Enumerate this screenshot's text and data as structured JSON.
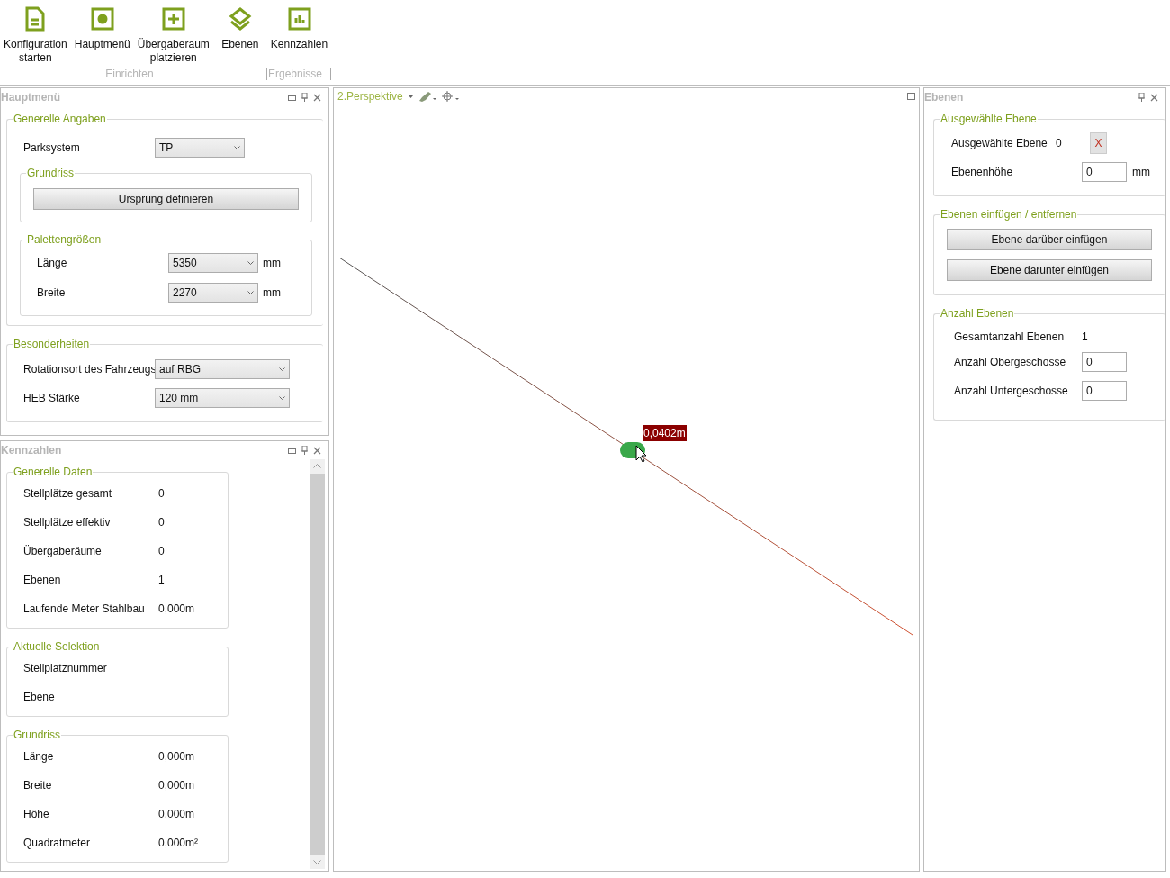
{
  "ribbon": {
    "groups": [
      {
        "label": "Einrichten",
        "buttons": [
          {
            "label": "Konfiguration\nstarten"
          },
          {
            "label": "Hauptmenü"
          },
          {
            "label": "Übergaberaum\nplatzieren"
          },
          {
            "label": "Ebenen"
          }
        ]
      },
      {
        "label": "Ergebnisse",
        "buttons": [
          {
            "label": "Kennzahlen"
          }
        ]
      }
    ]
  },
  "hauptmenue": {
    "title": "Hauptmenü",
    "generelle_angaben": {
      "title": "Generelle Angaben",
      "parksystem": {
        "label": "Parksystem",
        "value": "TP"
      },
      "grundriss": {
        "title": "Grundriss",
        "button": "Ursprung definieren"
      },
      "palettengroessen": {
        "title": "Palettengrößen",
        "rows": [
          {
            "label": "Länge",
            "value": "5350",
            "unit": "mm"
          },
          {
            "label": "Breite",
            "value": "2270",
            "unit": "mm"
          }
        ]
      }
    },
    "besonderheiten": {
      "title": "Besonderheiten",
      "rows": [
        {
          "label": "Rotationsort des Fahrzeugs",
          "value": "auf RBG"
        },
        {
          "label": "HEB Stärke",
          "value": "120 mm"
        }
      ]
    }
  },
  "kennzahlen": {
    "title": "Kennzahlen",
    "sections": [
      {
        "title": "Generelle Daten",
        "rows": [
          {
            "label": "Stellplätze gesamt",
            "value": "0"
          },
          {
            "label": "Stellplätze effektiv",
            "value": "0"
          },
          {
            "label": "Übergaberäume",
            "value": "0"
          },
          {
            "label": "Ebenen",
            "value": "1"
          },
          {
            "label": "Laufende Meter Stahlbau",
            "value": "0,000m"
          }
        ]
      },
      {
        "title": "Aktuelle Selektion",
        "rows": [
          {
            "label": "Stellplatznummer"
          },
          {
            "label": "Ebene"
          }
        ]
      },
      {
        "title": "Grundriss",
        "rows": [
          {
            "label": "Länge",
            "value": "0,000m"
          },
          {
            "label": "Breite",
            "value": "0,000m"
          },
          {
            "label": "Höhe",
            "value": "0,000m"
          },
          {
            "label": "Quadratmeter",
            "value": "0,000m²"
          }
        ]
      }
    ]
  },
  "viewport": {
    "title": "2.Perspektive",
    "measurement": "0,0402m"
  },
  "ebenen": {
    "title": "Ebenen",
    "ausgewaehlte": {
      "title": "Ausgewählte Ebene",
      "label": "Ausgewählte Ebene",
      "value": "0",
      "delete_button": "X",
      "hoehe_label": "Ebenenhöhe",
      "hoehe_value": "0",
      "unit": "mm"
    },
    "einfuegen": {
      "title": "Ebenen einfügen / entfernen",
      "buttons": [
        "Ebene darüber einfügen",
        "Ebene darunter einfügen"
      ]
    },
    "anzahl": {
      "title": "Anzahl Ebenen",
      "total_label": "Gesamtanzahl Ebenen",
      "total_value": "1",
      "fields": [
        {
          "label": "Anzahl Obergeschosse",
          "value": "0"
        },
        {
          "label": "Anzahl Untergeschosse",
          "value": "0"
        }
      ]
    }
  }
}
